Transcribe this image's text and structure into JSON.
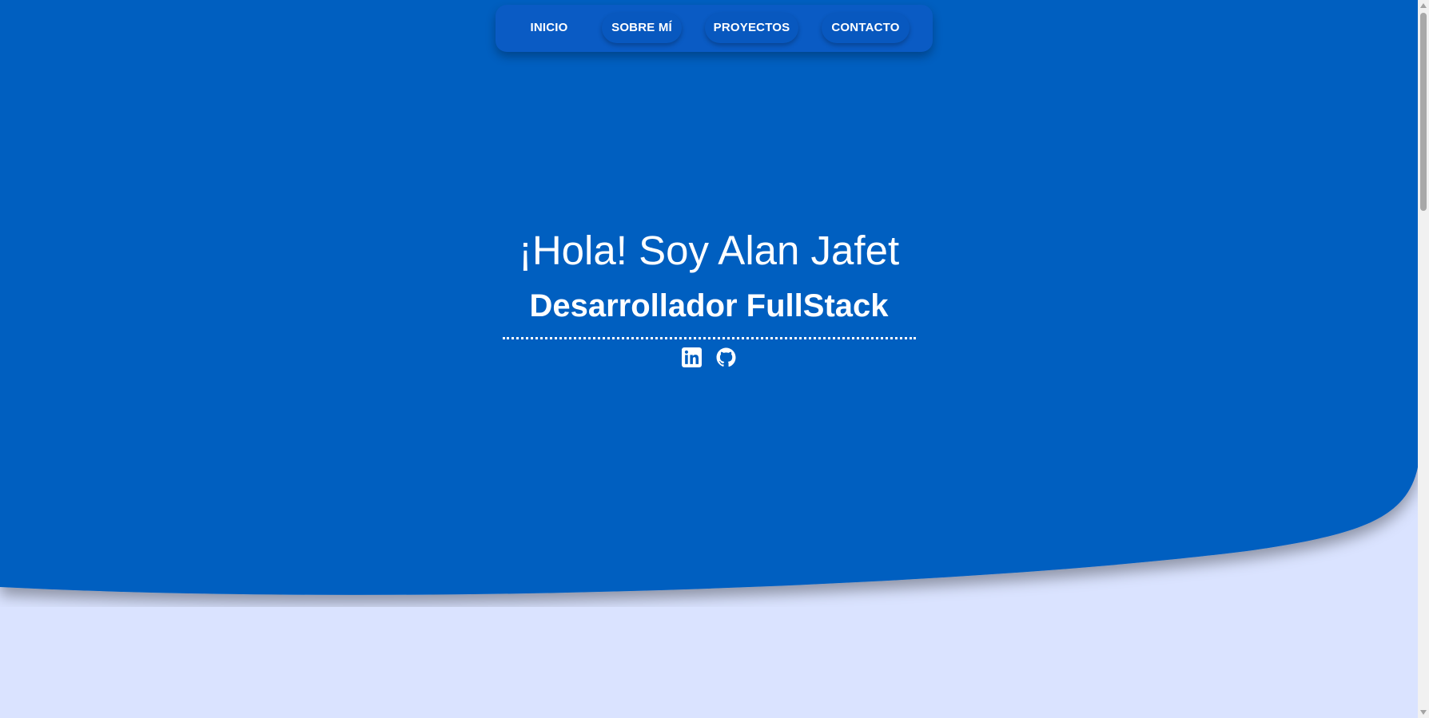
{
  "nav": {
    "items": [
      {
        "label": "INICIO"
      },
      {
        "label": "SOBRE MÍ"
      },
      {
        "label": "PROYECTOS"
      },
      {
        "label": "CONTACTO"
      }
    ]
  },
  "hero": {
    "title": "¡Hola! Soy Alan Jafet",
    "subtitle": "Desarrollador FullStack",
    "socials": [
      {
        "icon": "linkedin-icon"
      },
      {
        "icon": "github-icon"
      }
    ]
  },
  "colors": {
    "hero_blue": "#005ec0",
    "nav_blue": "#0a5bc4",
    "page_background": "#dae3ff",
    "text": "#ffffff"
  }
}
